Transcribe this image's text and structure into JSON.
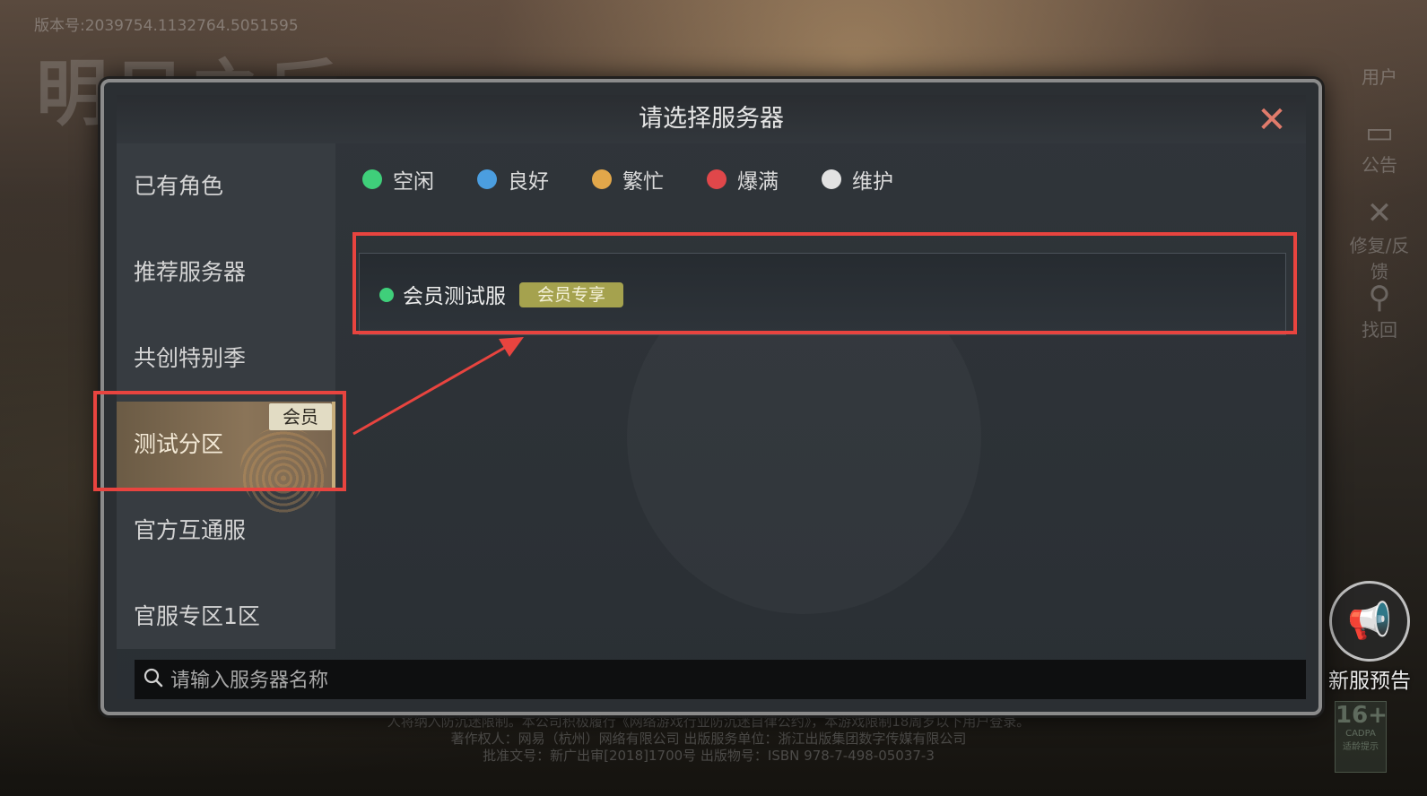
{
  "background": {
    "version_text": "版本号:2039754.1132764.5051595",
    "logo_text": "明日之后",
    "side_buttons": [
      {
        "label": "用户",
        "icon": "user-icon"
      },
      {
        "label": "公告",
        "icon": "notice-icon"
      },
      {
        "label": "修复/反馈",
        "icon": "wrench-icon"
      },
      {
        "label": "找回",
        "icon": "search-icon"
      }
    ],
    "new_server_label": "新服预告",
    "age_rating": {
      "number": "16+",
      "sub1": "CADPA",
      "sub2": "适龄提示"
    },
    "footer_lines": [
      "人将纳入防沉迷限制。本公司积极履行《网络游戏行业防沉迷自律公约》，本游戏限制18周岁以下用户登录。",
      "著作权人：网易（杭州）网络有限公司    出版服务单位：浙江出版集团数字传媒有限公司",
      "批准文号：新广出审[2018]1700号    出版物号：ISBN 978-7-498-05037-3"
    ]
  },
  "dialog": {
    "title": "请选择服务器",
    "close_icon": "close-icon",
    "tabs": [
      {
        "label": "已有角色",
        "active": false
      },
      {
        "label": "推荐服务器",
        "active": false
      },
      {
        "label": "共创特别季",
        "active": false
      },
      {
        "label": "测试分区",
        "active": true,
        "tag": "会员"
      },
      {
        "label": "官方互通服",
        "active": false
      },
      {
        "label": "官服专区1区",
        "active": false
      }
    ],
    "legend": [
      {
        "label": "空闲",
        "color": "#3fcf7a"
      },
      {
        "label": "良好",
        "color": "#4b9ee0"
      },
      {
        "label": "繁忙",
        "color": "#e2a74a"
      },
      {
        "label": "爆满",
        "color": "#e0474a"
      },
      {
        "label": "维护",
        "color": "#e2e2e2"
      }
    ],
    "servers": [
      {
        "name": "会员测试服",
        "status_color": "#3fcf7a",
        "badge": "会员专享"
      }
    ],
    "search": {
      "placeholder": "请输入服务器名称"
    }
  },
  "colors": {
    "annotation": "#e8443f",
    "accent_gold": "#c7ad7b"
  }
}
